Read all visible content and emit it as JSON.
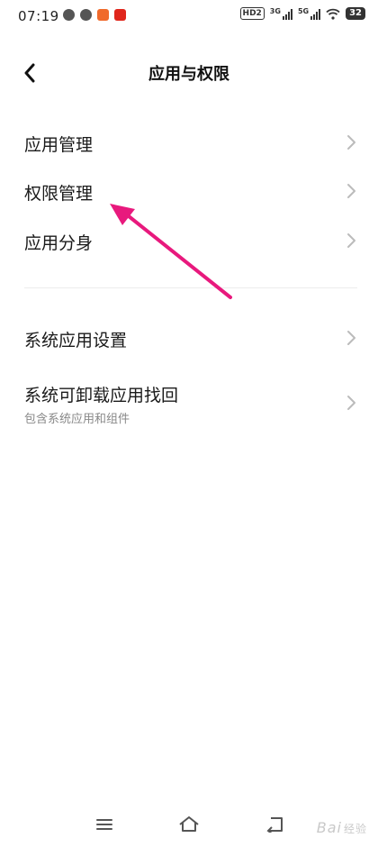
{
  "status_bar": {
    "time": "07:19",
    "hd_label": "HD2",
    "signal_1_label": "3G",
    "signal_2_label": "5G",
    "battery": "32"
  },
  "header": {
    "title": "应用与权限"
  },
  "menu": {
    "items": [
      {
        "label": "应用管理"
      },
      {
        "label": "权限管理"
      },
      {
        "label": "应用分身"
      },
      {
        "label": "系统应用设置"
      },
      {
        "label": "系统可卸载应用找回",
        "sub": "包含系统应用和组件"
      }
    ]
  },
  "annotation": {
    "arrow_color": "#e8197d"
  },
  "watermark": {
    "text": "Bai",
    "sub": "经验"
  }
}
